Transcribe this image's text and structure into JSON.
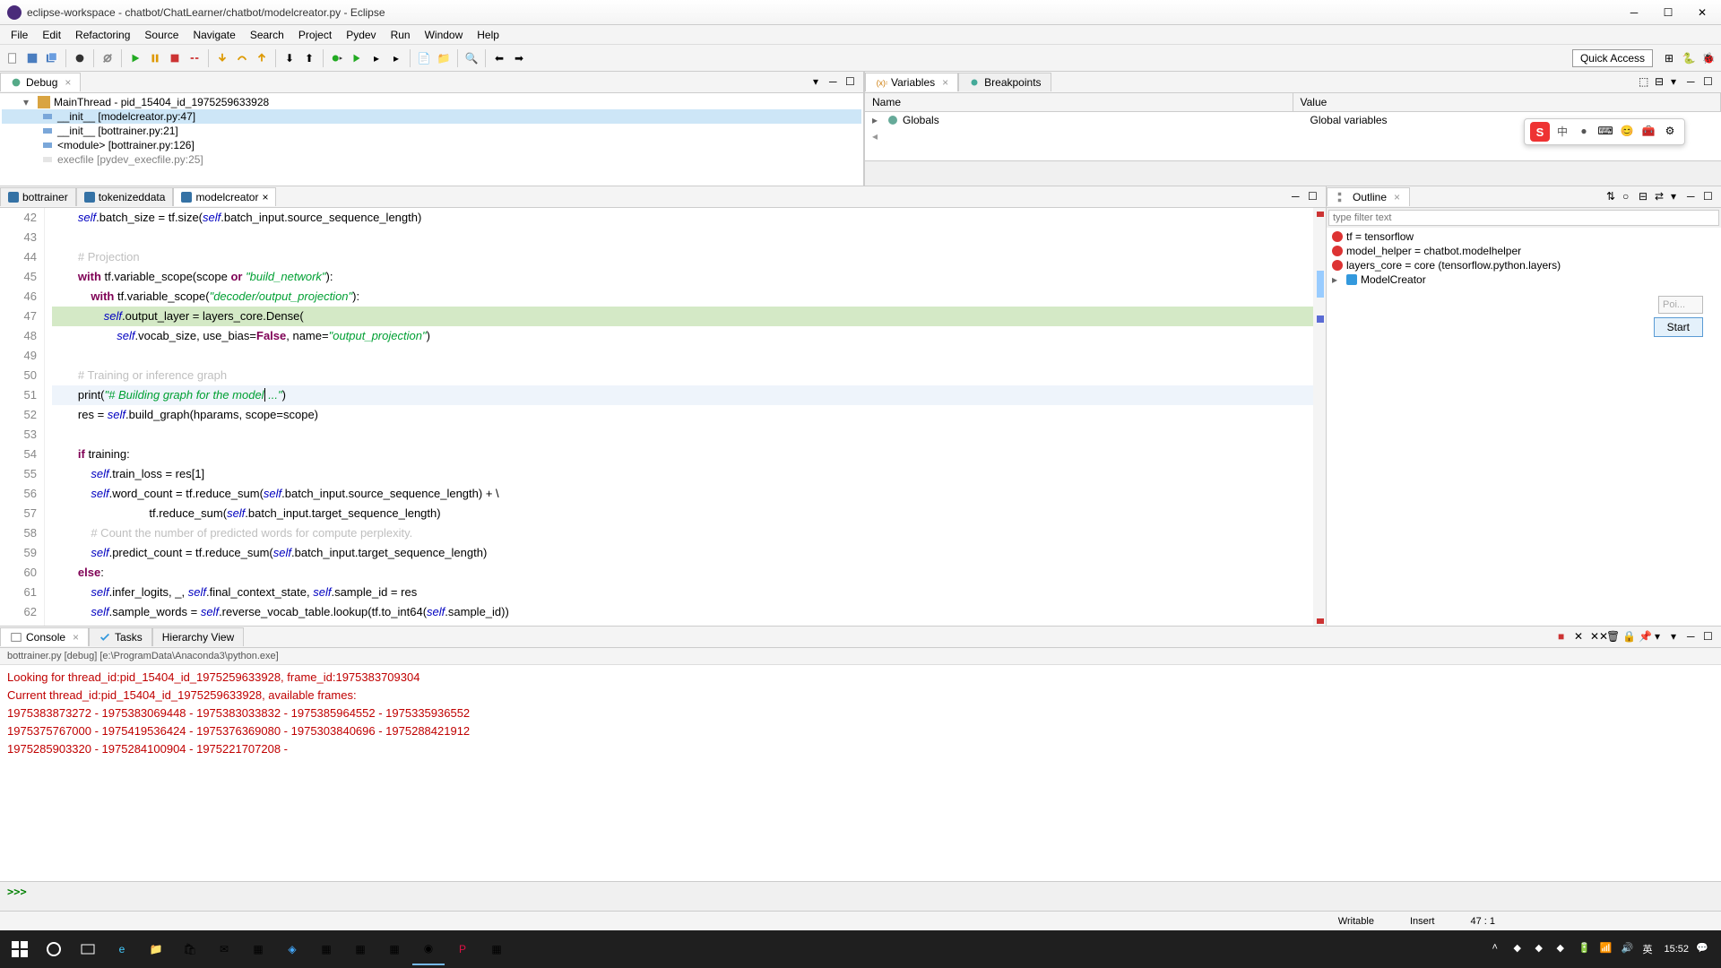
{
  "window": {
    "title": "eclipse-workspace - chatbot/ChatLearner/chatbot/modelcreator.py - Eclipse"
  },
  "menubar": [
    "File",
    "Edit",
    "Refactoring",
    "Source",
    "Navigate",
    "Search",
    "Project",
    "Pydev",
    "Run",
    "Window",
    "Help"
  ],
  "quick_access": "Quick Access",
  "debug": {
    "tab": "Debug",
    "thread": "MainThread - pid_15404_id_1975259633928",
    "frames": [
      "__init__ [modelcreator.py:47]",
      "__init__ [bottrainer.py:21]",
      "<module> [bottrainer.py:126]"
    ],
    "truncated": "execfile [pydev_execfile.py:25]"
  },
  "variables": {
    "tab": "Variables",
    "breakpoints_tab": "Breakpoints",
    "cols": {
      "name": "Name",
      "value": "Value"
    },
    "globals": "Globals",
    "globals_value": "Global variables"
  },
  "editor": {
    "tabs": [
      {
        "name": "bottrainer"
      },
      {
        "name": "tokenizeddata"
      },
      {
        "name": "modelcreator",
        "active": true
      }
    ],
    "lines": [
      {
        "n": 42,
        "html": "        <span class='self'>self</span>.batch_size = tf.size(<span class='self'>self</span>.batch_input.source_sequence_length)"
      },
      {
        "n": 43,
        "html": ""
      },
      {
        "n": 44,
        "html": "        <span class='com'># Projection</span>"
      },
      {
        "n": 45,
        "html": "        <span class='kw'>with</span> tf.variable_scope(scope <span class='kw'>or</span> <span class='str'>\"build_network\"</span>):"
      },
      {
        "n": 46,
        "html": "            <span class='kw'>with</span> tf.variable_scope(<span class='str'>\"decoder/output_projection\"</span>):"
      },
      {
        "n": 47,
        "hl": true,
        "html": "                <span class='self'>self</span>.output_layer = layers_core.Dense("
      },
      {
        "n": 48,
        "html": "                    <span class='self'>self</span>.vocab_size, use_bias=<span class='false'>False</span>, name=<span class='str'>\"output_projection\"</span>)"
      },
      {
        "n": 49,
        "html": ""
      },
      {
        "n": 50,
        "html": "        <span class='com'># Training or inference graph</span>"
      },
      {
        "n": 51,
        "cur": true,
        "html": "        print(<span class='str'>\"# Building graph for the model</span><span style='border-left:1px solid #000'></span><span class='str'> ...\"</span>)"
      },
      {
        "n": 52,
        "html": "        res = <span class='self'>self</span>.build_graph(hparams, scope=scope)"
      },
      {
        "n": 53,
        "html": ""
      },
      {
        "n": 54,
        "html": "        <span class='kw'>if</span> training:"
      },
      {
        "n": 55,
        "html": "            <span class='self'>self</span>.train_loss = res[1]"
      },
      {
        "n": 56,
        "html": "            <span class='self'>self</span>.word_count = tf.reduce_sum(<span class='self'>self</span>.batch_input.source_sequence_length) + \\"
      },
      {
        "n": 57,
        "html": "                              tf.reduce_sum(<span class='self'>self</span>.batch_input.target_sequence_length)"
      },
      {
        "n": 58,
        "html": "            <span class='com'># Count the number of predicted words for compute perplexity.</span>"
      },
      {
        "n": 59,
        "html": "            <span class='self'>self</span>.predict_count = tf.reduce_sum(<span class='self'>self</span>.batch_input.target_sequence_length)"
      },
      {
        "n": 60,
        "html": "        <span class='kw'>else</span>:"
      },
      {
        "n": 61,
        "html": "            <span class='self'>self</span>.infer_logits, _, <span class='self'>self</span>.final_context_state, <span class='self'>self</span>.sample_id = res"
      },
      {
        "n": 62,
        "html": "            <span class='self'>self</span>.sample_words = <span class='self'>self</span>.reverse_vocab_table.lookup(tf.to_int64(<span class='self'>self</span>.sample_id))"
      }
    ]
  },
  "outline": {
    "tab": "Outline",
    "filter_placeholder": "type filter text",
    "items": [
      "tf = tensorflow",
      "model_helper = chatbot.modelhelper",
      "layers_core = core (tensorflow.python.layers)",
      "ModelCreator"
    ],
    "start_input": "Poi...",
    "start_btn": "Start"
  },
  "console": {
    "tab": "Console",
    "tasks_tab": "Tasks",
    "hierarchy_tab": "Hierarchy View",
    "header": "bottrainer.py [debug] [e:\\ProgramData\\Anaconda3\\python.exe]",
    "lines": [
      "Looking for thread_id:pid_15404_id_1975259633928, frame_id:1975383709304",
      "  Current     thread_id:pid_15404_id_1975259633928, available frames:",
      "  1975383873272  -  1975383069448  -  1975383033832  -  1975385964552  -  1975335936552",
      "1975375767000  -  1975419536424  -  1975376369080  -  1975303840696  -  1975288421912",
      "1975285903320  -  1975284100904  -  1975221707208  -"
    ],
    "prompt": ">>>"
  },
  "status": {
    "writable": "Writable",
    "insert": "Insert",
    "pos": "47 : 1"
  },
  "taskbar": {
    "time": "15:52",
    "date_hint": ""
  }
}
